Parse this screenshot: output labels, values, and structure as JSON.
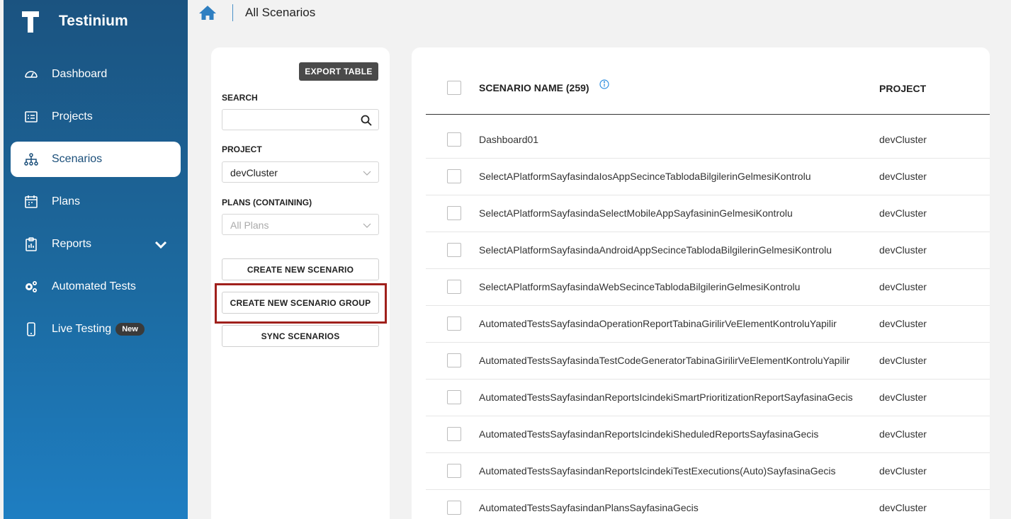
{
  "app": {
    "name": "Testinium"
  },
  "sidebar": {
    "items": [
      {
        "label": "Dashboard",
        "icon": "dashboard-gauge-icon"
      },
      {
        "label": "Projects",
        "icon": "projects-list-icon"
      },
      {
        "label": "Scenarios",
        "icon": "scenarios-tree-icon",
        "active": true
      },
      {
        "label": "Plans",
        "icon": "plans-calendar-icon"
      },
      {
        "label": "Reports",
        "icon": "reports-clipboard-icon",
        "expandable": true
      },
      {
        "label": "Automated Tests",
        "icon": "gears-icon"
      },
      {
        "label": "Live Testing",
        "icon": "mobile-phone-icon",
        "badge": "New"
      }
    ]
  },
  "header": {
    "breadcrumb_title": "All Scenarios"
  },
  "filters": {
    "export_label": "EXPORT TABLE",
    "search_label": "SEARCH",
    "search_value": "",
    "project_label": "PROJECT",
    "project_value": "devCluster",
    "plans_label": "PLANS (CONTAINING)",
    "plans_value": "All Plans",
    "create_scenario_label": "CREATE NEW SCENARIO",
    "create_group_label": "CREATE NEW SCENARIO GROUP",
    "sync_label": "SYNC SCENARIOS"
  },
  "table": {
    "columns": {
      "name": "SCENARIO NAME (259)",
      "project": "PROJECT"
    },
    "rows": [
      {
        "name": "Dashboard01",
        "project": "devCluster"
      },
      {
        "name": "SelectAPlatformSayfasindaIosAppSecinceTablodaBilgilerinGelmesiKontrolu",
        "project": "devCluster"
      },
      {
        "name": "SelectAPlatformSayfasindaSelectMobileAppSayfasininGelmesiKontrolu",
        "project": "devCluster"
      },
      {
        "name": "SelectAPlatformSayfasindaAndroidAppSecinceTablodaBilgilerinGelmesiKontrolu",
        "project": "devCluster"
      },
      {
        "name": "SelectAPlatformSayfasindaWebSecinceTablodaBilgilerinGelmesiKontrolu",
        "project": "devCluster"
      },
      {
        "name": "AutomatedTestsSayfasindaOperationReportTabinaGirilirVeElementKontroluYapilir",
        "project": "devCluster"
      },
      {
        "name": "AutomatedTestsSayfasindaTestCodeGeneratorTabinaGirilirVeElementKontroluYapilir",
        "project": "devCluster"
      },
      {
        "name": "AutomatedTestsSayfasindanReportsIcindekiSmartPrioritizationReportSayfasinaGecis",
        "project": "devCluster"
      },
      {
        "name": "AutomatedTestsSayfasindanReportsIcindekiSheduledReportsSayfasinaGecis",
        "project": "devCluster"
      },
      {
        "name": "AutomatedTestsSayfasindanReportsIcindekiTestExecutions(Auto)SayfasinaGecis",
        "project": "devCluster"
      },
      {
        "name": "AutomatedTestsSayfasindanPlansSayfasinaGecis",
        "project": "devCluster"
      }
    ]
  }
}
